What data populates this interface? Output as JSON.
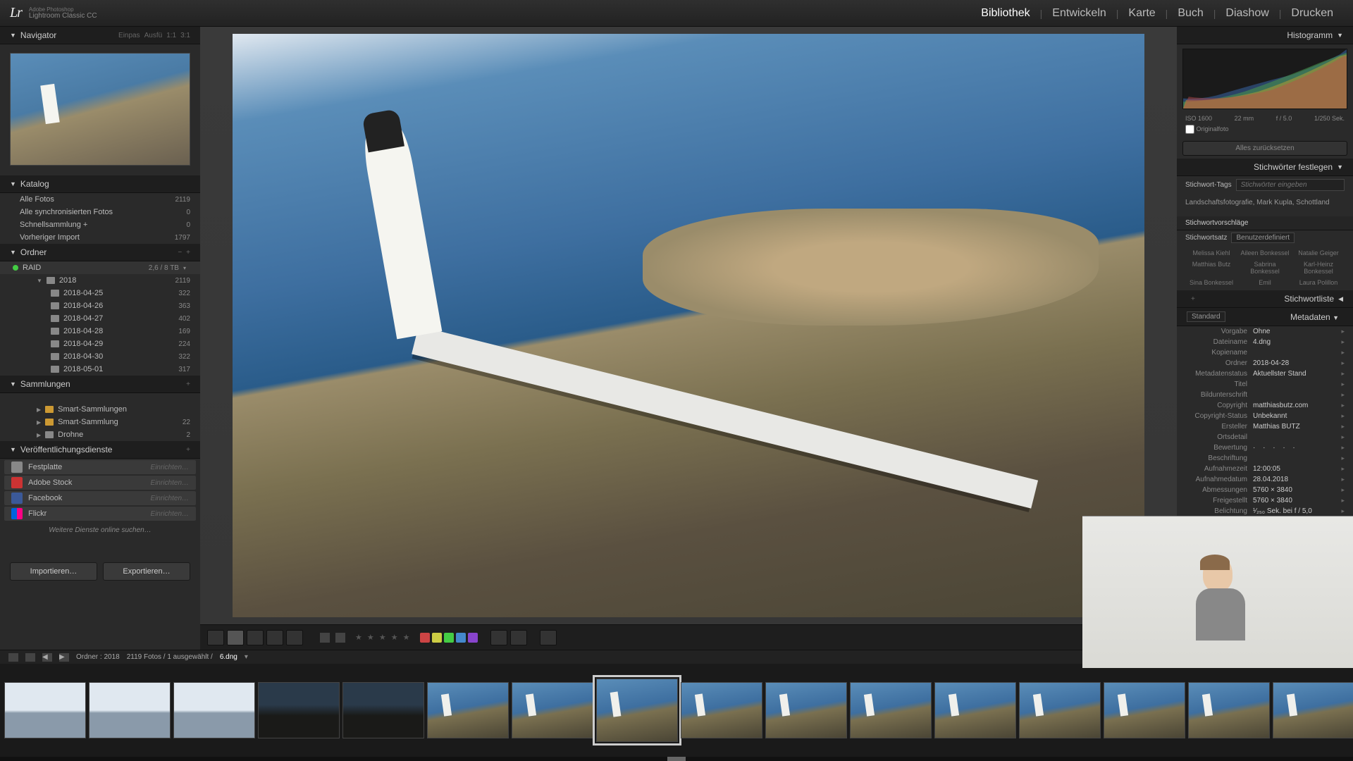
{
  "app": {
    "brand_small": "Adobe Photoshop",
    "brand": "Lightroom Classic CC",
    "logo": "Lr"
  },
  "modules": [
    "Bibliothek",
    "Entwickeln",
    "Karte",
    "Buch",
    "Diashow",
    "Drucken"
  ],
  "active_module": "Bibliothek",
  "left": {
    "navigator": {
      "title": "Navigator",
      "modes": [
        "Einpas",
        "Ausfü",
        "1:1",
        "3:1"
      ]
    },
    "catalog": {
      "title": "Katalog",
      "items": [
        {
          "label": "Alle Fotos",
          "count": "2119"
        },
        {
          "label": "Alle synchronisierten Fotos",
          "count": "0"
        },
        {
          "label": "Schnellsammlung  +",
          "count": "0"
        },
        {
          "label": "Vorheriger Import",
          "count": "1797"
        }
      ]
    },
    "folders": {
      "title": "Ordner",
      "drive": "RAID",
      "drive_info": "2,6 / 8 TB",
      "year": {
        "label": "2018",
        "count": "2119"
      },
      "dates": [
        {
          "label": "2018-04-25",
          "count": "322"
        },
        {
          "label": "2018-04-26",
          "count": "363"
        },
        {
          "label": "2018-04-27",
          "count": "402"
        },
        {
          "label": "2018-04-28",
          "count": "169"
        },
        {
          "label": "2018-04-29",
          "count": "224"
        },
        {
          "label": "2018-04-30",
          "count": "322"
        },
        {
          "label": "2018-05-01",
          "count": "317"
        }
      ]
    },
    "collections": {
      "title": "Sammlungen",
      "items": [
        {
          "label": "Smart-Sammlungen",
          "count": "",
          "smart": true
        },
        {
          "label": "Smart-Sammlung",
          "count": "22",
          "smart": true
        },
        {
          "label": "Drohne",
          "count": "2"
        }
      ]
    },
    "publish": {
      "title": "Veröffentlichungsdienste",
      "services": [
        {
          "label": "Festplatte",
          "action": "Einrichten…",
          "cls": "hd"
        },
        {
          "label": "Adobe Stock",
          "action": "Einrichten…",
          "cls": "stock"
        },
        {
          "label": "Facebook",
          "action": "Einrichten…",
          "cls": "fb"
        },
        {
          "label": "Flickr",
          "action": "Einrichten…",
          "cls": "flickr"
        }
      ],
      "more": "Weitere Dienste online suchen…"
    },
    "import_btn": "Importieren…",
    "export_btn": "Exportieren…"
  },
  "right": {
    "histogram": {
      "title": "Histogramm"
    },
    "exif": {
      "iso": "ISO 1600",
      "focal": "22 mm",
      "aperture": "f / 5.0",
      "shutter": "1/250 Sek."
    },
    "original_chk": "Originalfoto",
    "reset_btn": "Alles zurücksetzen",
    "keywords": {
      "title": "Stichwörter festlegen",
      "tags_label": "Stichwort-Tags",
      "input_placeholder": "Stichwörter eingeben",
      "tags_value": "Landschaftsfotografie, Mark Kupla, Schottland"
    },
    "suggestions": {
      "title": "Stichwortvorschläge",
      "set_label": "Stichwortsatz",
      "set_value": "Benutzerdefiniert",
      "names": [
        "Melissa Kiehl",
        "Aileen Bonkessel",
        "Natalie Geiger",
        "Matthias Butz",
        "Sabrina Bonkessel",
        "Karl-Heinz Bonkessel",
        "Sina Bonkessel",
        "Emil",
        "Laura Polillon"
      ]
    },
    "keywordlist_title": "Stichwortliste",
    "meta_hdr": {
      "std": "Standard",
      "title": "Metadaten"
    },
    "meta": [
      {
        "k": "Vorgabe",
        "v": "Ohne"
      },
      {
        "k": "Dateiname",
        "v": "4.dng"
      },
      {
        "k": "Kopiename",
        "v": ""
      },
      {
        "k": "Ordner",
        "v": "2018-04-28"
      },
      {
        "k": "Metadatenstatus",
        "v": "Aktuellster Stand"
      },
      {
        "k": "Titel",
        "v": ""
      },
      {
        "k": "Bildunterschrift",
        "v": ""
      },
      {
        "k": "Copyright",
        "v": "matthiasbutz.com"
      },
      {
        "k": "Copyright-Status",
        "v": "Unbekannt"
      },
      {
        "k": "Ersteller",
        "v": "Matthias BUTZ"
      },
      {
        "k": "Ortsdetail",
        "v": ""
      },
      {
        "k": "Bewertung",
        "v": "·  ·  ·  ·  ·"
      },
      {
        "k": "Beschriftung",
        "v": ""
      },
      {
        "k": "Aufnahmezeit",
        "v": "12:00:05"
      },
      {
        "k": "Aufnahmedatum",
        "v": "28.04.2018"
      },
      {
        "k": "Abmessungen",
        "v": "5760 × 3840"
      },
      {
        "k": "Freigestellt",
        "v": "5760 × 3840"
      },
      {
        "k": "Belichtung",
        "v": "¹⁄₂₅₀ Sek. bei f / 5,0"
      }
    ]
  },
  "toolbar": {
    "color_tags": [
      "#c44",
      "#cc4",
      "#4c4",
      "#48c",
      "#84c"
    ]
  },
  "status": {
    "path": "Ordner : 2018",
    "count": "2119 Fotos / 1 ausgewählt /",
    "file": "6.dng"
  },
  "filmstrip": {
    "selected_index": 7,
    "thumbs": [
      "bright",
      "bright",
      "bright",
      "dark",
      "dark",
      "lh",
      "lh",
      "lh",
      "lh",
      "lh",
      "lh",
      "lh",
      "lh",
      "lh",
      "lh",
      "lh",
      "lh"
    ]
  }
}
